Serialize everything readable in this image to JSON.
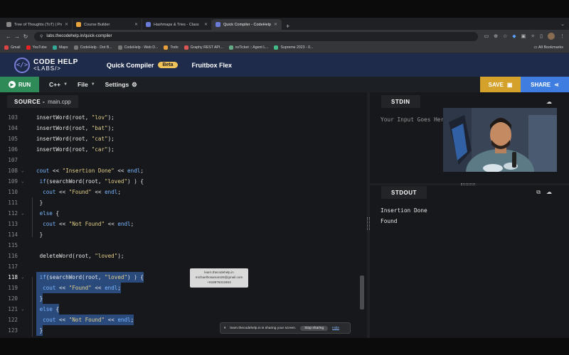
{
  "browser": {
    "tabs": [
      {
        "label": "Tree of Thoughts (ToT) | Prom",
        "active": false
      },
      {
        "label": "Course Builder",
        "active": false
      },
      {
        "label": "Hashmaps & Tries - Class",
        "active": false
      },
      {
        "label": "Quick Compiler - CodeHelp L",
        "active": true
      }
    ],
    "url": "labs.thecodehelp.in/quick-compiler",
    "bookmarks": [
      "Gmail",
      "YouTube",
      "Maps",
      "CodeHelp - Dot B...",
      "CodeHelp - Web D...",
      "Todo",
      "Graphy REST API...",
      "nsTicket :: Agent L...",
      "Supreme 2023 - 0..."
    ],
    "all_bookmarks": "All Bookmarks"
  },
  "header": {
    "logo_line1": "CODE HELP",
    "logo_line2": "<LABS/>",
    "nav_quick": "Quick Compiler",
    "beta": "Beta",
    "nav_fruitbox": "Fruitbox Flex"
  },
  "toolbar": {
    "run": "RUN",
    "language": "C++",
    "file": "File",
    "settings": "Settings",
    "save": "SAVE",
    "share": "SHARE"
  },
  "editor": {
    "source_label": "SOURCE -",
    "filename": "main.cpp",
    "lines": [
      {
        "n": "103",
        "code": "insertWord(root, \"lov\");"
      },
      {
        "n": "104",
        "code": "insertWord(root, \"bat\");"
      },
      {
        "n": "105",
        "code": "insertWord(root, \"cat\");"
      },
      {
        "n": "106",
        "code": "insertWord(root, \"car\");"
      },
      {
        "n": "107",
        "code": ""
      },
      {
        "n": "108",
        "code": "cout << \"Insertion Done\" << endl;"
      },
      {
        "n": "109",
        "code": " if(searchWord(root, \"loved\") ) {"
      },
      {
        "n": "110",
        "code": "  cout << \"Found\" << endl;"
      },
      {
        "n": "111",
        "code": " }"
      },
      {
        "n": "112",
        "code": " else {"
      },
      {
        "n": "113",
        "code": "  cout << \"Not Found\" << endl;"
      },
      {
        "n": "114",
        "code": " }"
      },
      {
        "n": "115",
        "code": ""
      },
      {
        "n": "116",
        "code": " deleteWord(root, \"loved\");"
      },
      {
        "n": "117",
        "code": ""
      },
      {
        "n": "118",
        "code": " if(searchWord(root, \"loved\") ) {"
      },
      {
        "n": "119",
        "code": "  cout << \"Found\" << endl;"
      },
      {
        "n": "120",
        "code": " }"
      },
      {
        "n": "121",
        "code": " else {"
      },
      {
        "n": "122",
        "code": "  cout << \"Not Found\" << endl;"
      },
      {
        "n": "123",
        "code": " }"
      }
    ]
  },
  "watermark": {
    "line1": "learn.thecodehelp.in",
    "line2": "michaelhosamani26@gmail.com",
    "line3": "+918976313453"
  },
  "screen_share": {
    "message": "learn.thecodehelp.in is sharing your screen.",
    "stop": "Stop sharing",
    "hide": "Hide"
  },
  "stdin": {
    "title": "STDIN",
    "placeholder": "Your Input Goes Here"
  },
  "stdout": {
    "title": "STDOUT",
    "lines": [
      "Insertion Done",
      "Found"
    ]
  },
  "colors": {
    "run": "#2e8b57",
    "save": "#d4a12a",
    "share": "#3f7de0",
    "header_bg": "#1e2b4a",
    "beta": "#f0c25a",
    "selection": "#2b4a7c"
  }
}
